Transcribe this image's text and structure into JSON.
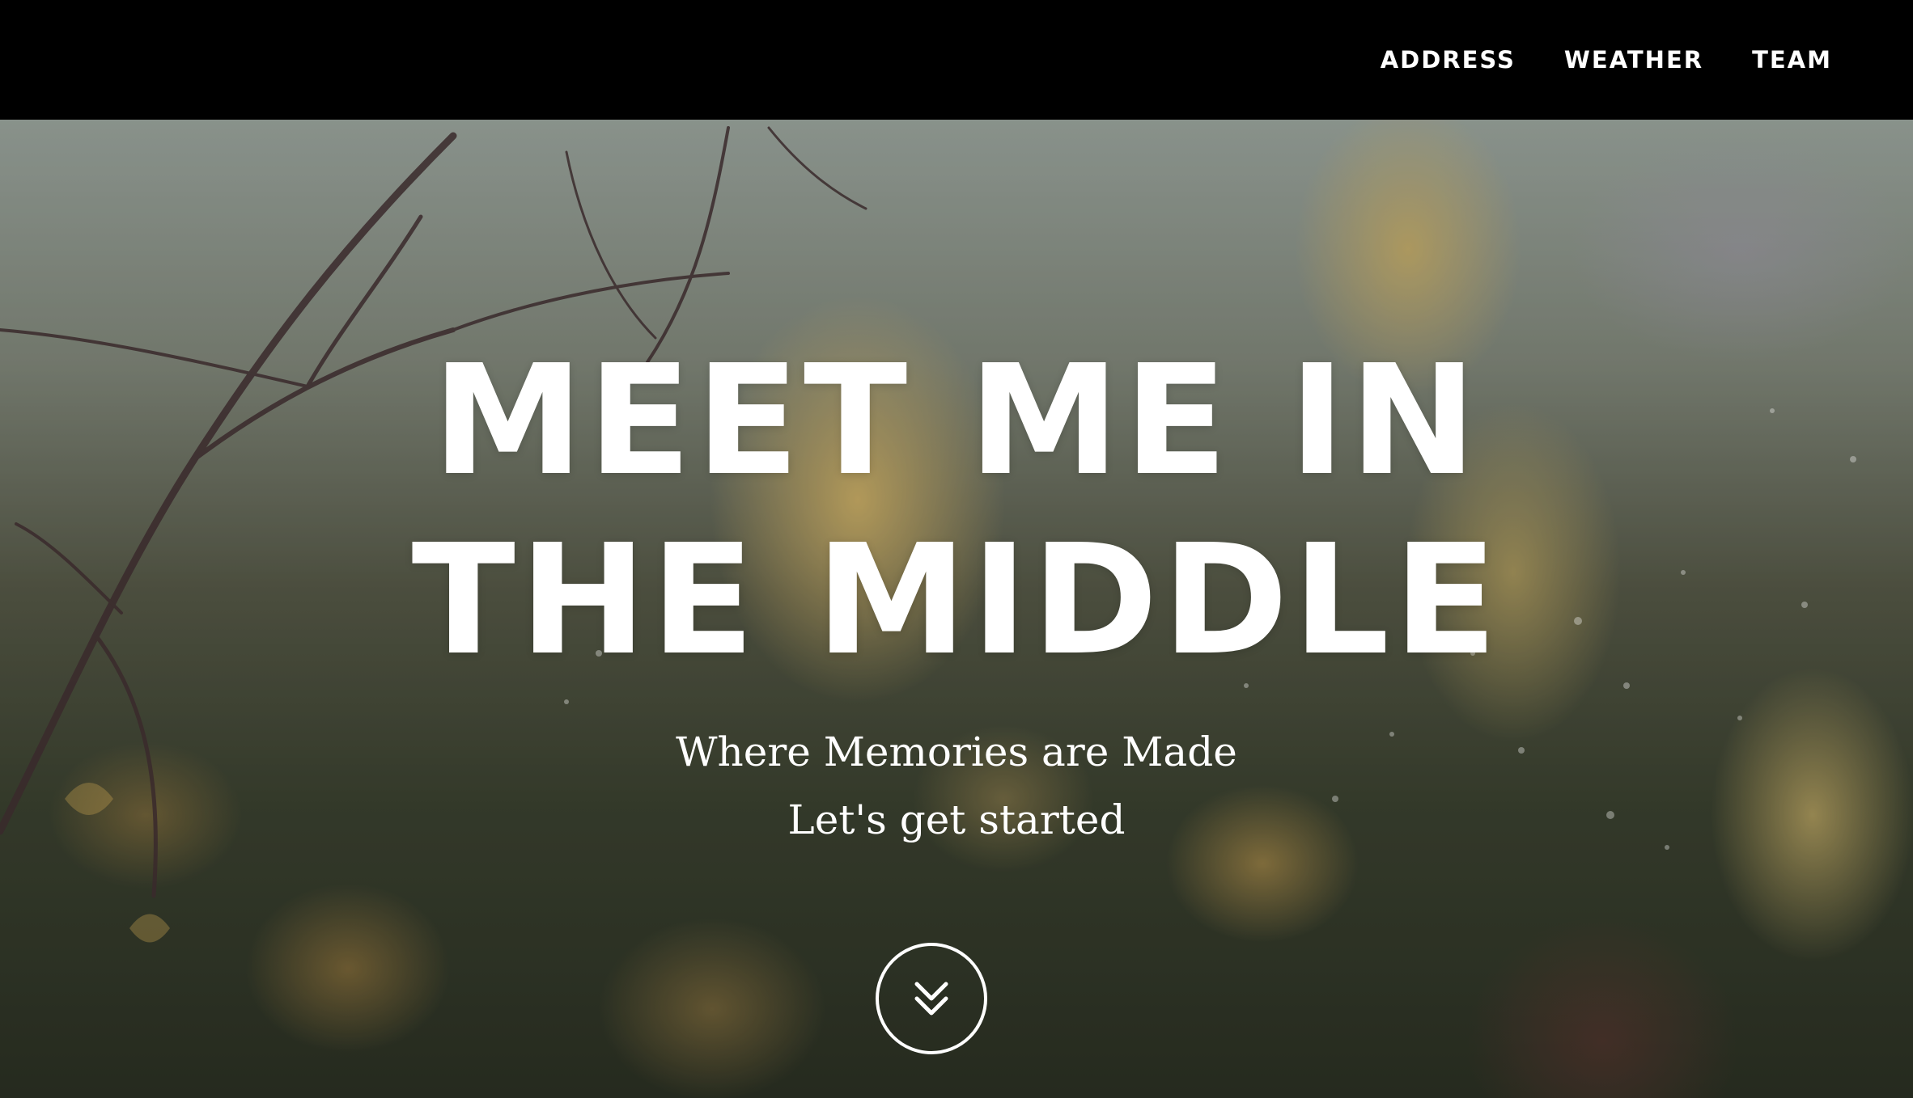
{
  "nav": {
    "items": [
      {
        "label": "ADDRESS"
      },
      {
        "label": "WEATHER"
      },
      {
        "label": "TEAM"
      }
    ]
  },
  "hero": {
    "title_line1": "MEET ME IN",
    "title_line2": "THE MIDDLE",
    "subtitle_line1": "Where Memories are Made",
    "subtitle_line2": "Let's get started",
    "scroll_icon": "double-chevron-down-icon"
  },
  "colors": {
    "navbar_bg": "#000000",
    "text": "#ffffff",
    "leaf_accent": "#debe6e"
  }
}
